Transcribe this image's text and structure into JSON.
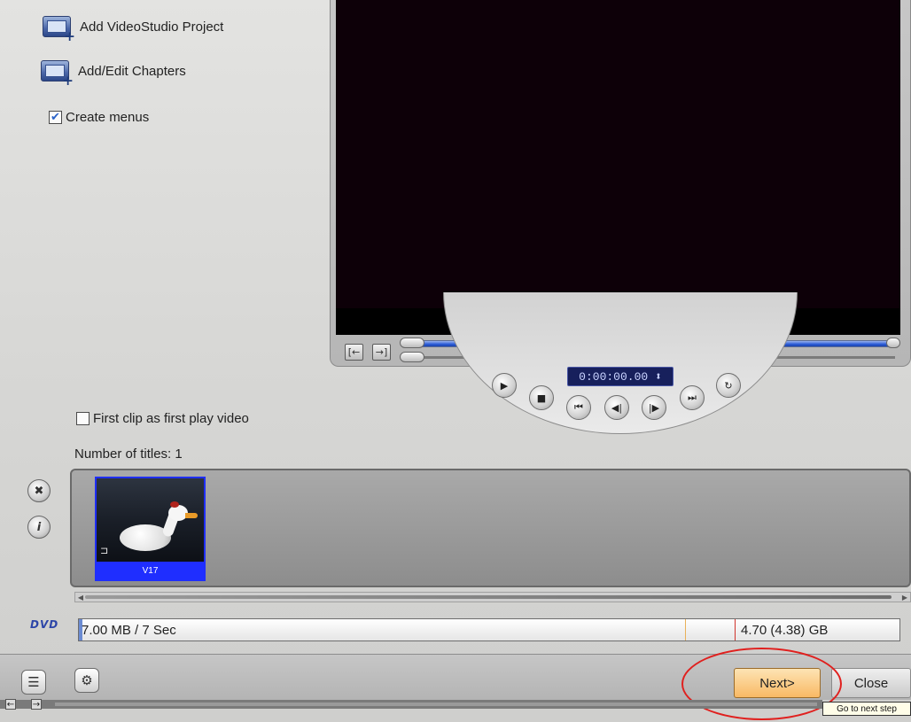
{
  "options": {
    "add_project": "Add VideoStudio Project",
    "add_chapters": "Add/Edit Chapters",
    "create_menus": "Create menus",
    "create_menus_checked": "✔"
  },
  "preview": {
    "timecode": "0:00:00.00 ⬍",
    "mark_in_icon": "[←",
    "mark_out_icon": "→]",
    "transport": {
      "play": "▶",
      "stop": "■",
      "home": "⏮",
      "prev_frame": "◀|",
      "next_frame": "|▶",
      "end": "⏭",
      "repeat": "↻"
    }
  },
  "titles": {
    "first_clip_label": "First clip as first play video",
    "count_label": "Number of titles: 1",
    "remove_icon": "✖",
    "info_icon": "i",
    "thumb_label": "V17",
    "thumb_corner": "⊐"
  },
  "capacity": {
    "logo": "DVD",
    "used": "7.00 MB / 7 Sec",
    "total": "4.70 (4.38) GB"
  },
  "footer": {
    "list_icon": "☰",
    "settings_icon": "⚙",
    "next_label": "Next>",
    "close_label": "Close",
    "tooltip": "Go to next step",
    "back_arrow": "←",
    "fwd_arrow": "→"
  },
  "colors": {
    "accent": "#1f2eff",
    "next_button": "#f9b964",
    "highlight_ellipse": "#e0201e"
  }
}
